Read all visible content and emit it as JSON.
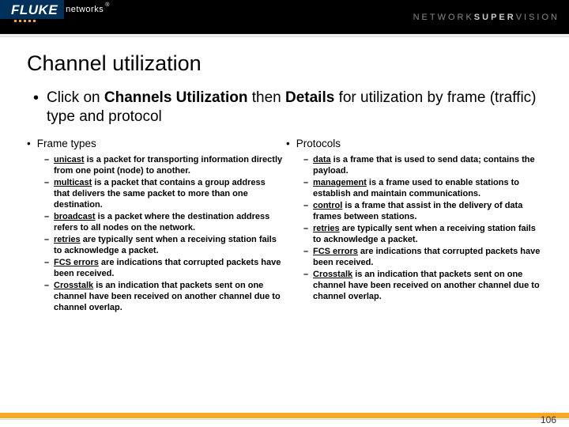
{
  "brand": {
    "fluke": "FLUKE",
    "networks": "networks",
    "reg": "®",
    "super1": "NETWORK",
    "super2": "SUPER",
    "super3": "VISION"
  },
  "title": "Channel utilization",
  "intro_dot": "•",
  "intro_pre": "Click on ",
  "intro_b1": "Channels Utilization",
  "intro_mid": " then ",
  "intro_b2": "Details",
  "intro_post": " for utilization by frame (traffic) type and protocol",
  "frame_head": "Frame types",
  "proto_head": "Protocols",
  "frame": [
    {
      "t": "unicast",
      "d": " is a packet for transporting information directly from one point (node) to another."
    },
    {
      "t": "multicast",
      "d": " is a packet that contains a group address that delivers the same packet to more than one destination."
    },
    {
      "t": "broadcast",
      "d": " is a packet where the destination address refers to all nodes on the network."
    },
    {
      "t": "retries",
      "d": " are typically sent when a receiving station fails to acknowledge a packet."
    },
    {
      "t": "FCS errors",
      "d": " are indications that corrupted packets have been received."
    },
    {
      "t": "Crosstalk",
      "d": " is an indication that packets sent on one channel have been received on another channel due to channel overlap."
    }
  ],
  "proto": [
    {
      "t": "data",
      "d": " is a frame that is used to send data; contains the payload."
    },
    {
      "t": "management",
      "d": " is a frame used to enable stations to establish and maintain communications."
    },
    {
      "t": "control",
      "d": " is a frame that assist in the delivery of data frames between stations."
    },
    {
      "t": "retries",
      "d": " are typically sent when a receiving station fails to acknowledge a packet."
    },
    {
      "t": "FCS errors",
      "d": " are indications that corrupted packets have been received."
    },
    {
      "t": "Crosstalk",
      "d": " is an indication that packets sent on one channel have been received on another channel due to channel overlap."
    }
  ],
  "page": "106"
}
